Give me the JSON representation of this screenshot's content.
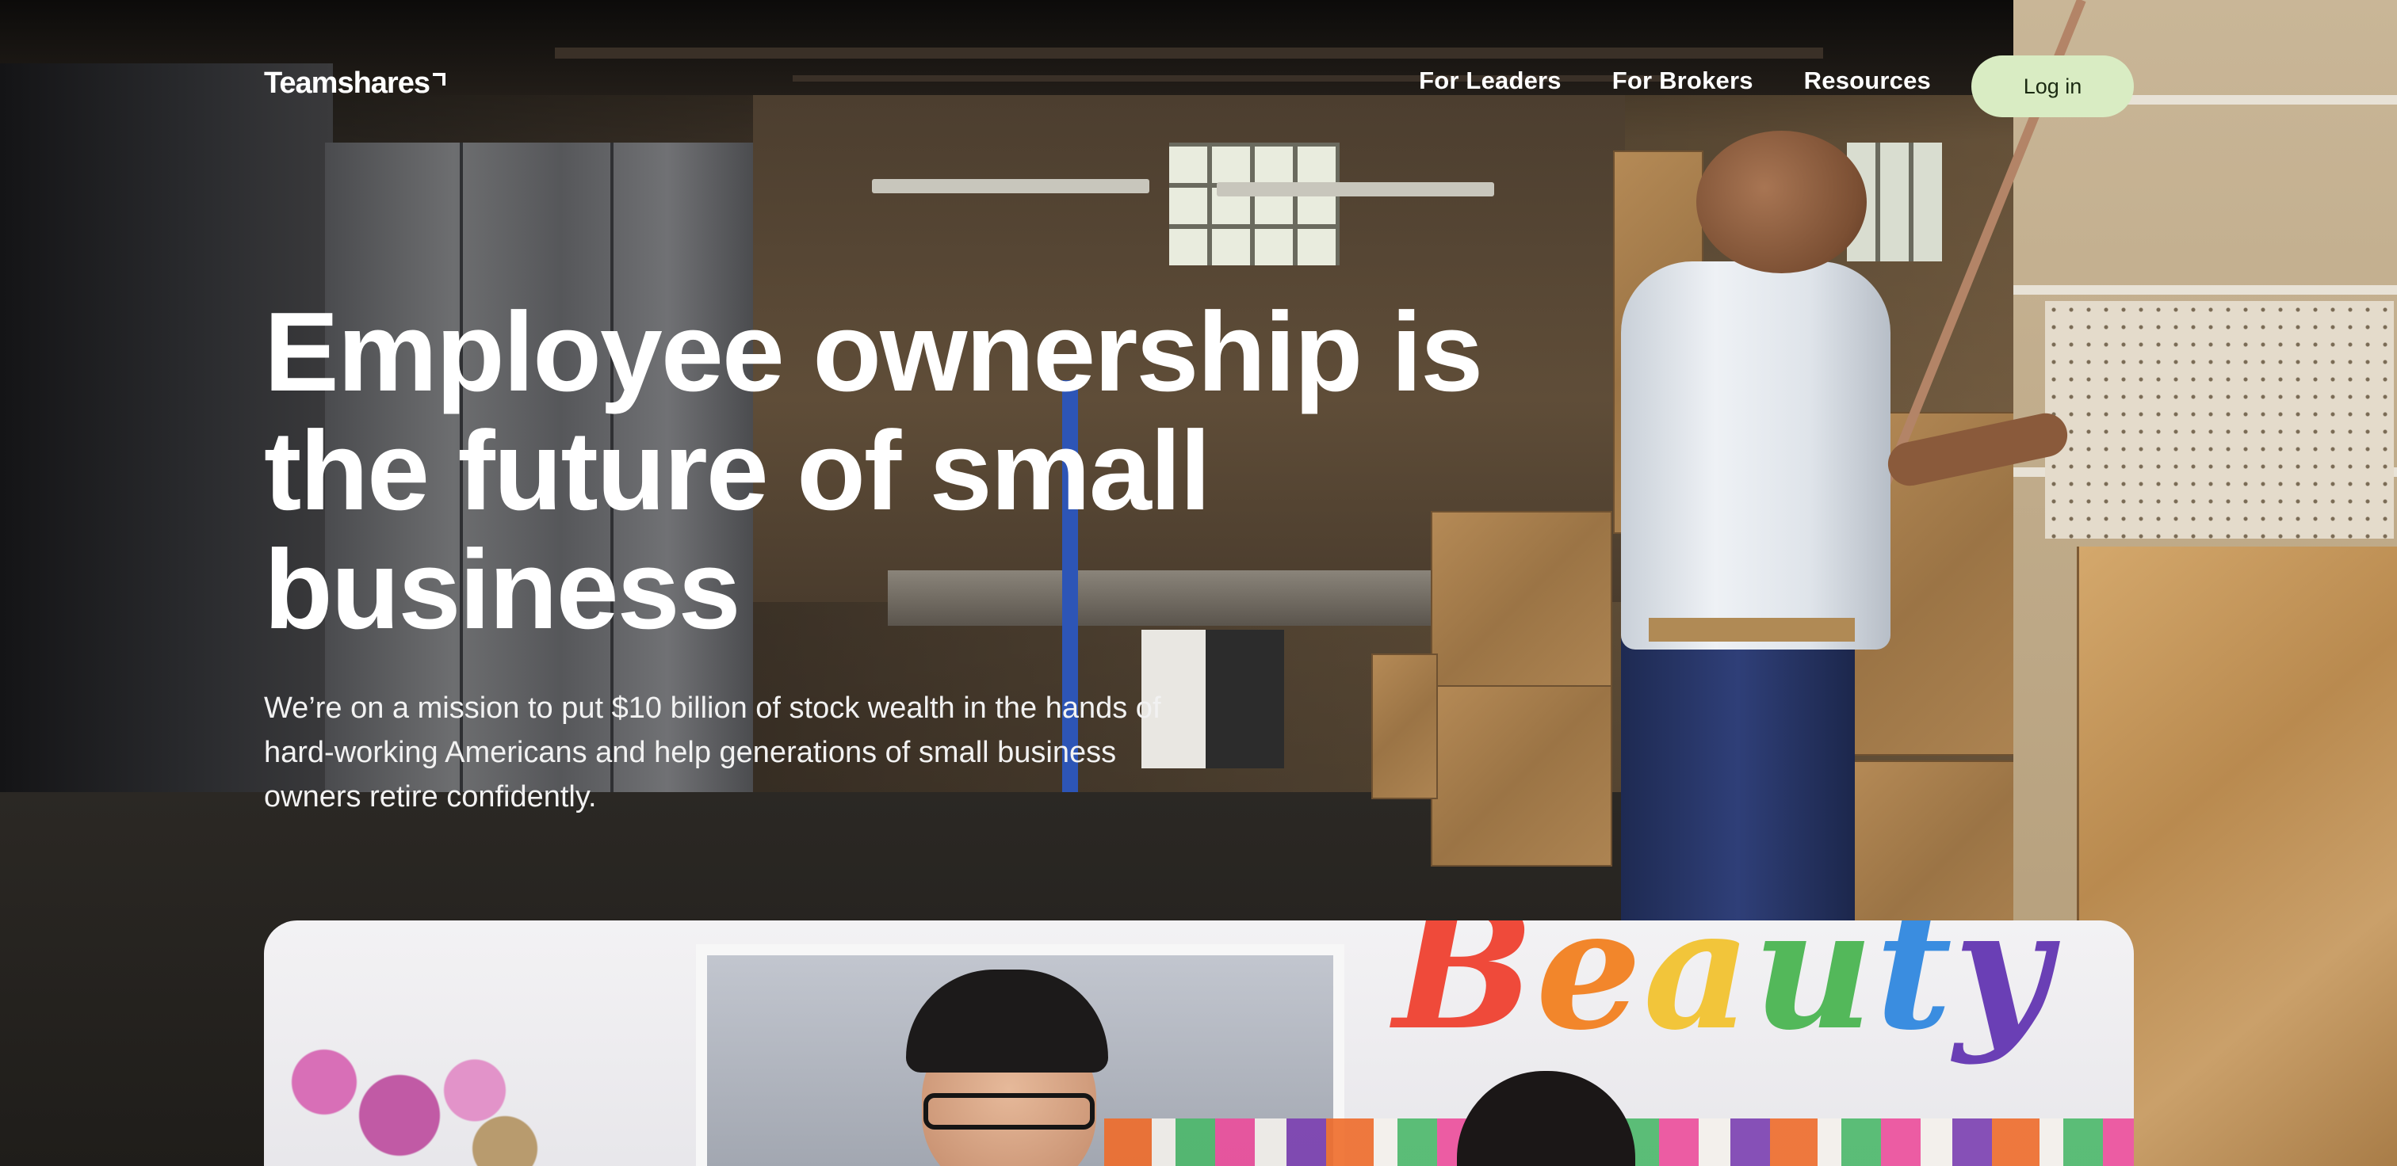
{
  "brand": {
    "logo_text": "Teamshares"
  },
  "nav": {
    "links": [
      {
        "label": "For Leaders"
      },
      {
        "label": "For Brokers"
      },
      {
        "label": "Resources"
      }
    ],
    "login_label": "Log in"
  },
  "hero": {
    "title": "Employee ownership is the future of small business",
    "subtitle": "We’re on a mission to put $10 billion of stock wealth in the hands of hard-working Americans and help generations of small business owners retire confidently."
  },
  "media": {
    "sign_text": "Beauty",
    "sign_colors": [
      "#ef4a3a",
      "#f2862b",
      "#f2c53a",
      "#53b85a",
      "#3a8de0",
      "#6a3fb5"
    ]
  },
  "colors": {
    "login_button_bg": "#d9ecc3",
    "text": "#ffffff"
  }
}
